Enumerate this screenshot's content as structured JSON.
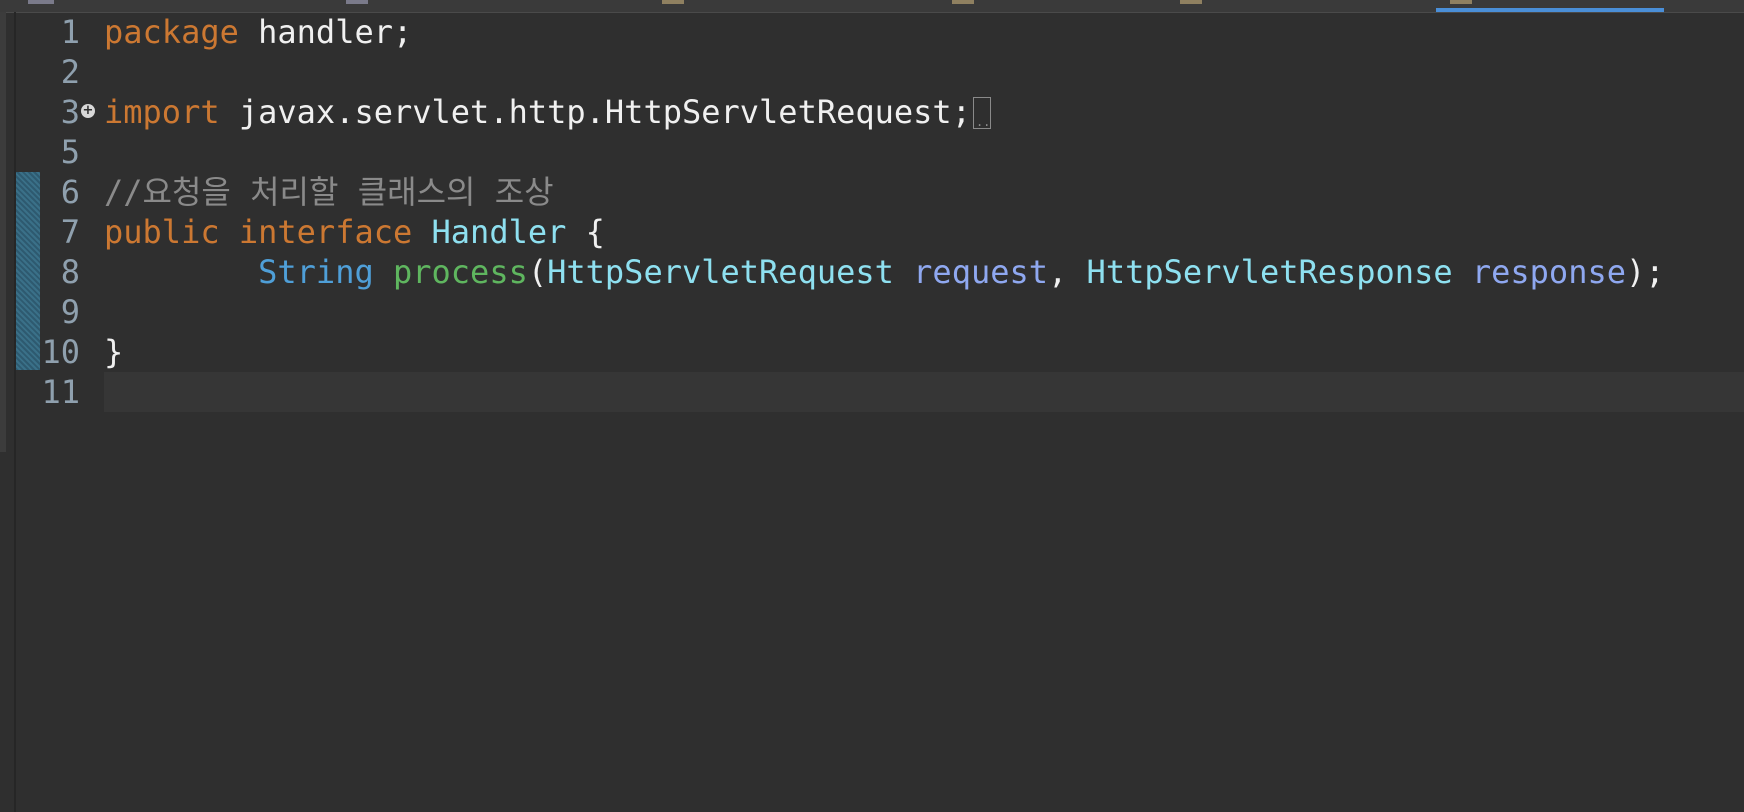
{
  "editor": {
    "lines": [
      {
        "number": "1",
        "tokens": [
          {
            "text": "package",
            "cls": "kw"
          },
          {
            "text": " handler;",
            "cls": "plain"
          }
        ]
      },
      {
        "number": "2",
        "tokens": []
      },
      {
        "number": "3",
        "folded": true,
        "tokens": [
          {
            "text": "import",
            "cls": "kw"
          },
          {
            "text": " javax.servlet.http.HttpServletRequest;",
            "cls": "plain"
          }
        ]
      },
      {
        "number": "5",
        "tokens": []
      },
      {
        "number": "6",
        "tokens": [
          {
            "text": "//요청을 처리할 클래스의 조상",
            "cls": "comment"
          }
        ]
      },
      {
        "number": "7",
        "tokens": [
          {
            "text": "public",
            "cls": "kw"
          },
          {
            "text": " ",
            "cls": "plain"
          },
          {
            "text": "interface",
            "cls": "kw"
          },
          {
            "text": " ",
            "cls": "plain"
          },
          {
            "text": "Handler",
            "cls": "type"
          },
          {
            "text": " {",
            "cls": "plain"
          }
        ]
      },
      {
        "number": "8",
        "tokens": [
          {
            "text": "        ",
            "cls": "plain"
          },
          {
            "text": "String",
            "cls": "builtin"
          },
          {
            "text": " ",
            "cls": "plain"
          },
          {
            "text": "process",
            "cls": "method"
          },
          {
            "text": "(",
            "cls": "plain"
          },
          {
            "text": "HttpServletRequest",
            "cls": "type"
          },
          {
            "text": " ",
            "cls": "plain"
          },
          {
            "text": "request",
            "cls": "param"
          },
          {
            "text": ", ",
            "cls": "plain"
          },
          {
            "text": "HttpServletResponse",
            "cls": "type"
          },
          {
            "text": " ",
            "cls": "plain"
          },
          {
            "text": "response",
            "cls": "param"
          },
          {
            "text": ");",
            "cls": "plain"
          }
        ]
      },
      {
        "number": "9",
        "tokens": []
      },
      {
        "number": "10",
        "tokens": [
          {
            "text": "}",
            "cls": "plain"
          }
        ]
      },
      {
        "number": "11",
        "tokens": []
      }
    ],
    "fold_icon": "plus-circle-icon",
    "colors": {
      "background": "#2f2f2f",
      "keyword": "#cc7832",
      "comment": "#8a8a8a",
      "type": "#8ee0f0",
      "builtin": "#4f9fd8",
      "method": "#5fb65f",
      "parameter": "#8fa8f0",
      "line_number": "#8fa0ae"
    }
  }
}
